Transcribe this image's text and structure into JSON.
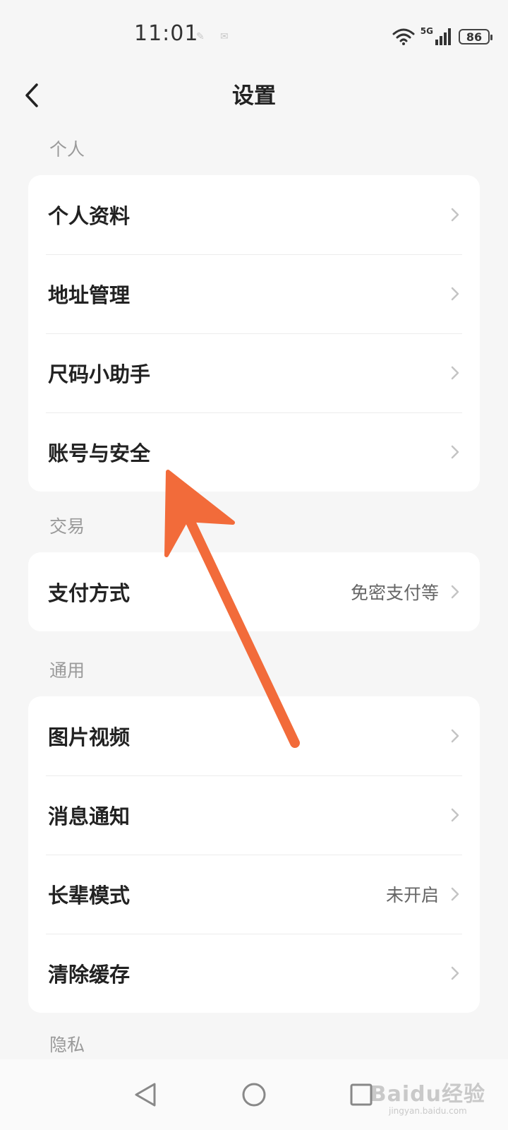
{
  "status_bar": {
    "time": "11:01",
    "network": "5G",
    "battery": "86"
  },
  "header": {
    "title": "设置"
  },
  "sections": [
    {
      "label": "个人",
      "items": [
        {
          "label": "个人资料",
          "value": ""
        },
        {
          "label": "地址管理",
          "value": ""
        },
        {
          "label": "尺码小助手",
          "value": ""
        },
        {
          "label": "账号与安全",
          "value": ""
        }
      ]
    },
    {
      "label": "交易",
      "items": [
        {
          "label": "支付方式",
          "value": "免密支付等"
        }
      ]
    },
    {
      "label": "通用",
      "items": [
        {
          "label": "图片视频",
          "value": ""
        },
        {
          "label": "消息通知",
          "value": ""
        },
        {
          "label": "长辈模式",
          "value": "未开启"
        },
        {
          "label": "清除缓存",
          "value": ""
        }
      ]
    },
    {
      "label": "隐私",
      "items": []
    }
  ],
  "watermark": {
    "main": "Baidu经验",
    "sub": "jingyan.baidu.com"
  },
  "colors": {
    "background": "#f6f6f6",
    "card": "#ffffff",
    "annotation_arrow": "#f26b3a"
  }
}
